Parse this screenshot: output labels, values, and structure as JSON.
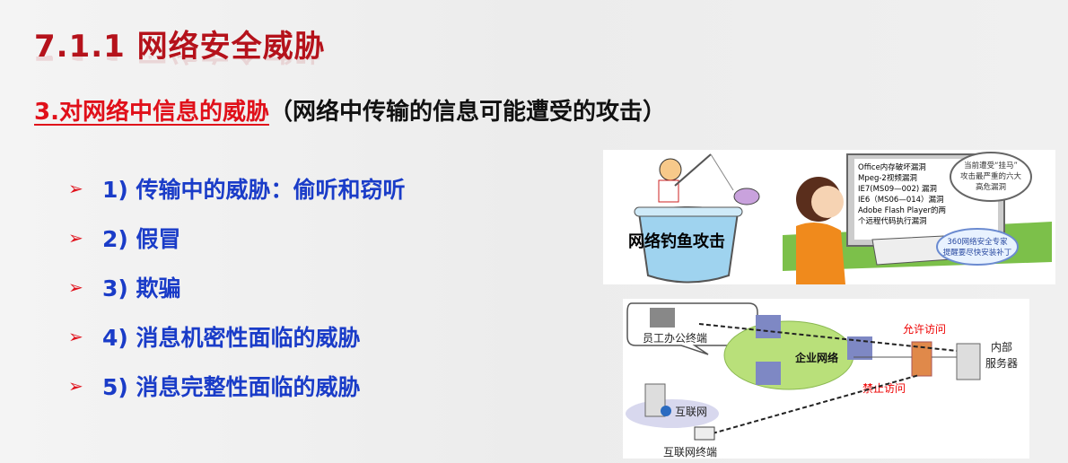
{
  "slide": {
    "title": "7.1.1  网络安全威胁",
    "subtitle_highlight": "3.对网络中信息的威胁",
    "subtitle_rest": "（网络中传输的信息可能遭受的攻击）",
    "bullets": [
      {
        "label": "1) 传输中的威胁：偷听和窃听"
      },
      {
        "label": "2) 假冒"
      },
      {
        "label": "3) 欺骗"
      },
      {
        "label": "4) 消息机密性面临的威胁"
      },
      {
        "label": "5) 消息完整性面临的威胁"
      }
    ],
    "bullet_icon": "arrow-bullet-icon"
  },
  "phishing_image": {
    "caption": "网络钓鱼攻击",
    "screen_lines": [
      "Office内存破坏漏洞",
      "Mpeg-2视频漏洞",
      "IE7(MS09—002) 漏洞",
      "IE6（MS06—014）漏洞",
      "Adobe Flash Player的两",
      "个远程代码执行漏洞"
    ],
    "bubble_top": [
      "当前遭受“挂马”",
      "攻击最严重的六大",
      "高危漏洞"
    ],
    "bubble_bottom": [
      "360网络安全专家",
      "提醒要尽快安装补丁"
    ]
  },
  "network_diagram": {
    "employee": "员工办公终端",
    "enterprise": "企业网络",
    "allow": "允许访问",
    "deny": "禁止访问",
    "server": [
      "内部",
      "服务器"
    ],
    "internet": "互联网",
    "internet_terminal": "互联网终端"
  },
  "colors": {
    "title": "#b5121b",
    "highlight": "#e0101a",
    "bullet_text": "#1a3cc8"
  }
}
